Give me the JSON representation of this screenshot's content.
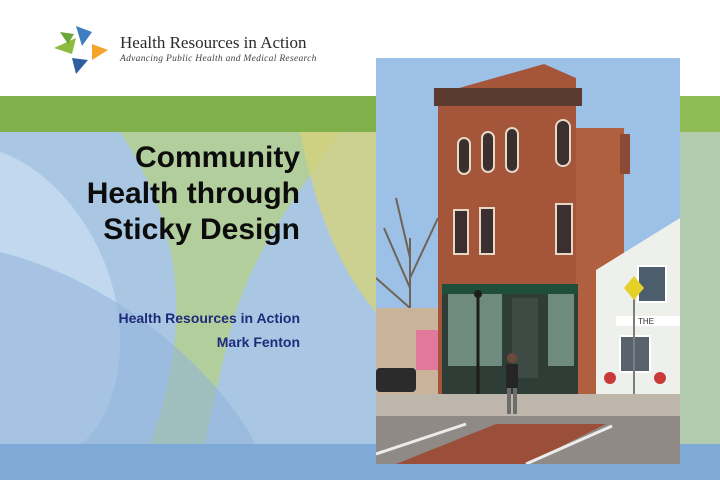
{
  "brand": {
    "name": "Health Resources in Action",
    "tagline": "Advancing Public Health and Medical Research"
  },
  "slide": {
    "title_lines": [
      "Community",
      "Health through",
      "Sticky Design"
    ],
    "organization": "Health Resources in Action",
    "presenter": "Mark Fenton"
  },
  "photo": {
    "storefront_sign": "THE"
  },
  "colors": {
    "green_band": "#7fb04a",
    "light_blue": "#a9c7e3",
    "blue_strip": "#7fa9d6",
    "subtitle_blue": "#1e2b7a",
    "brick": "#a4553a"
  }
}
